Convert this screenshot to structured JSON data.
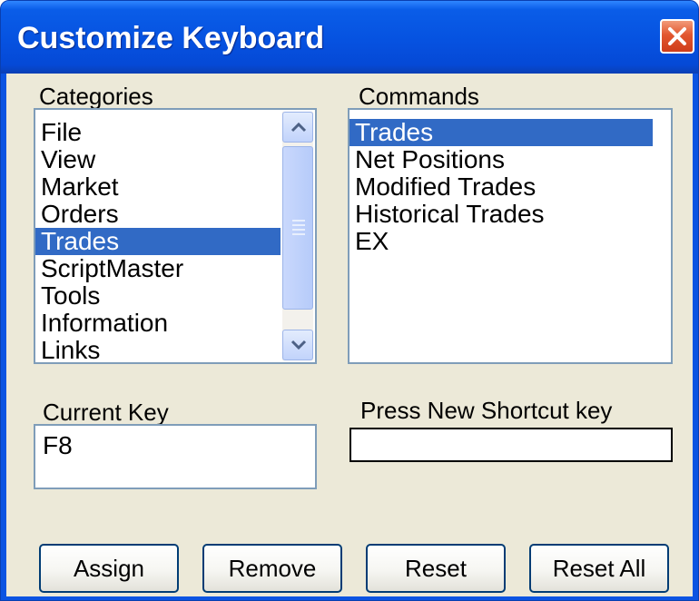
{
  "window": {
    "title": "Customize Keyboard"
  },
  "categories": {
    "label": "Categories",
    "items": [
      "File",
      "View",
      "Market",
      "Orders",
      "Trades",
      "ScriptMaster",
      "Tools",
      "Information",
      "Links"
    ],
    "selected": "Trades"
  },
  "commands": {
    "label": "Commands",
    "items": [
      "Trades",
      "Net Positions",
      "Modified Trades",
      "Historical Trades",
      "EX"
    ],
    "selected": "Trades"
  },
  "current_key": {
    "label": "Current Key",
    "value": "F8"
  },
  "new_shortcut": {
    "label": "Press New Shortcut key",
    "value": ""
  },
  "buttons": {
    "assign": "Assign",
    "remove": "Remove",
    "reset": "Reset",
    "reset_all": "Reset All"
  },
  "colors": {
    "title_bar": "#0b54e2",
    "dialog_bg": "#ece9d8",
    "selection": "#316ac5",
    "close_button": "#e2572f"
  }
}
